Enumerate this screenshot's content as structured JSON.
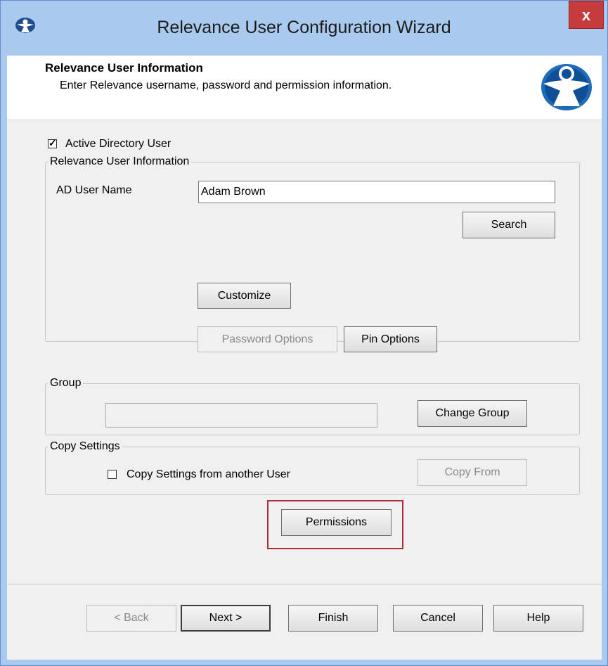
{
  "window": {
    "title": "Relevance User Configuration Wizard",
    "close_label": "x"
  },
  "header": {
    "title": "Relevance User Information",
    "subtitle": "Enter Relevance username, password and permission information.",
    "logo_icon": "thinmanager-logo-icon"
  },
  "active_directory": {
    "label": "Active Directory User",
    "checked": true
  },
  "user_info": {
    "legend": "Relevance User Information",
    "ad_user_name_label": "AD User Name",
    "ad_user_name_value": "Adam Brown",
    "search_label": "Search",
    "customize_label": "Customize",
    "password_options_label": "Password Options",
    "pin_options_label": "Pin Options"
  },
  "group": {
    "legend": "Group",
    "value": "",
    "change_group_label": "Change Group"
  },
  "copy_settings": {
    "legend": "Copy Settings",
    "checkbox_label": "Copy Settings from another User",
    "checked": false,
    "copy_from_label": "Copy From"
  },
  "permissions_label": "Permissions",
  "footer": {
    "back_label": "< Back",
    "next_label": "Next >",
    "finish_label": "Finish",
    "cancel_label": "Cancel",
    "help_label": "Help"
  },
  "colors": {
    "titlebar": "#a9c9ee",
    "close": "#c63b3b",
    "highlight": "#b22a35"
  }
}
